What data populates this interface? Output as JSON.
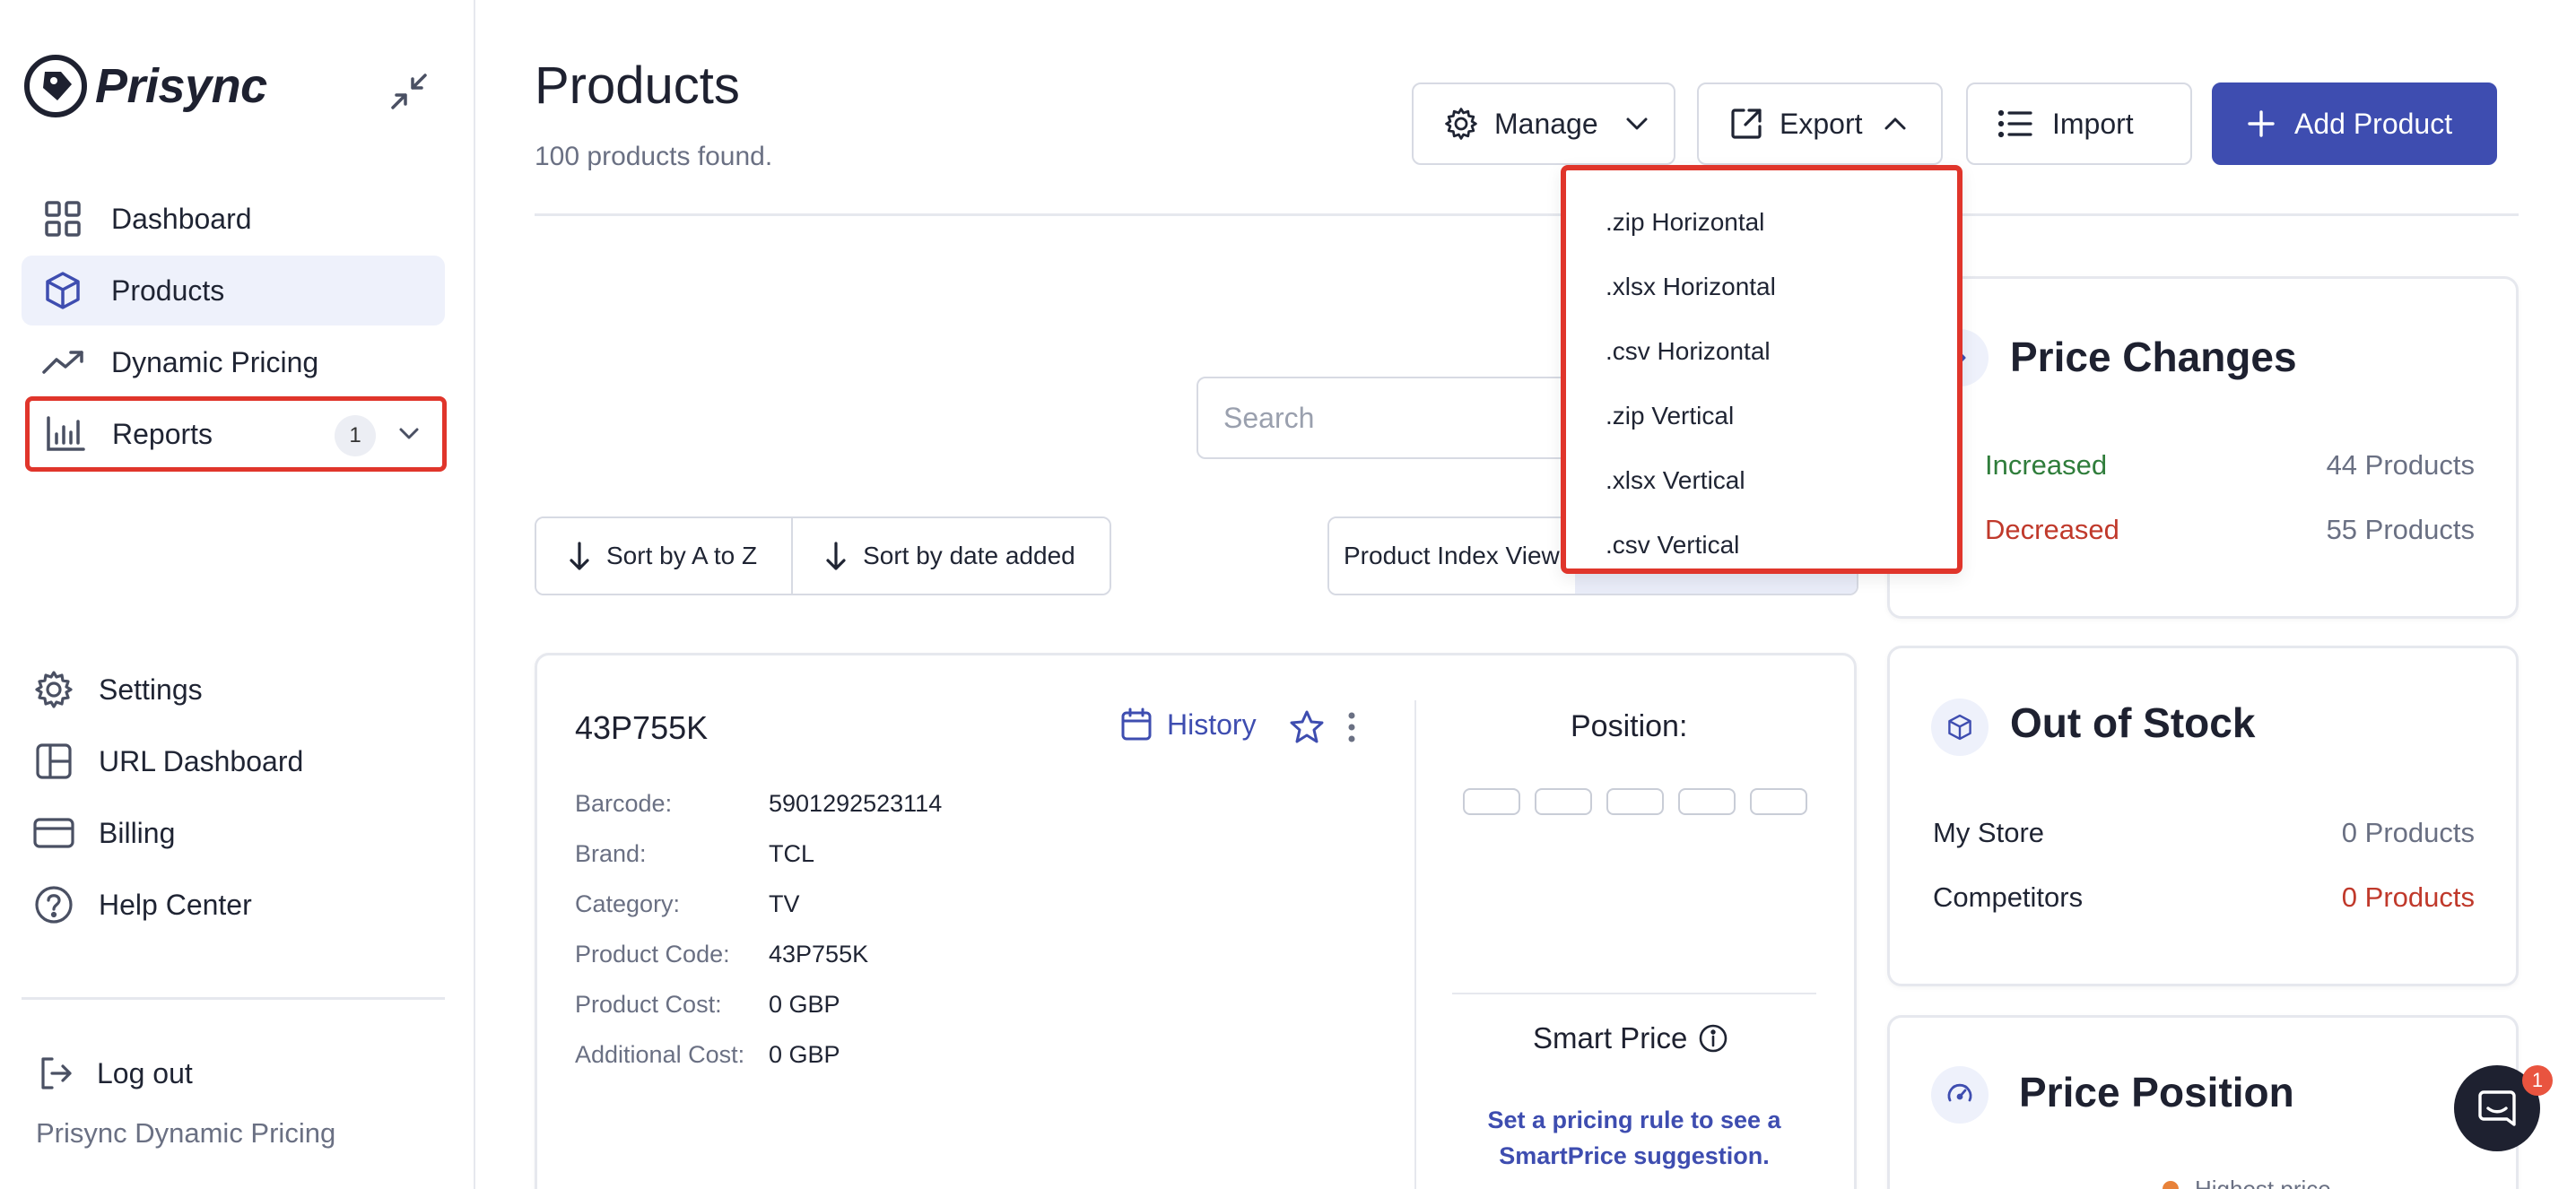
{
  "app": {
    "brand": "Prisync",
    "colors": {
      "accent": "#3e4db0",
      "highlight_border": "#e0352b",
      "increase": "#2f7d3b",
      "decrease": "#c0392b"
    }
  },
  "sidebar": {
    "items": [
      {
        "label": "Dashboard",
        "icon": "grid-icon"
      },
      {
        "label": "Products",
        "icon": "cube-icon",
        "active": true
      },
      {
        "label": "Dynamic Pricing",
        "icon": "trend-up-icon"
      },
      {
        "label": "Reports",
        "icon": "bar-chart-icon",
        "badge": "1"
      }
    ],
    "bottom_items": [
      {
        "label": "Settings",
        "icon": "gear-icon"
      },
      {
        "label": "URL Dashboard",
        "icon": "layout-icon"
      },
      {
        "label": "Billing",
        "icon": "credit-card-icon"
      },
      {
        "label": "Help Center",
        "icon": "help-circle-icon"
      }
    ],
    "logout_label": "Log out",
    "footer_text": "Prisync Dynamic Pricing"
  },
  "header": {
    "title": "Products",
    "subtitle": "100 products found.",
    "manage_label": "Manage",
    "export_label": "Export",
    "import_label": "Import",
    "add_label": "Add Product"
  },
  "export_menu": {
    "items": [
      ".zip Horizontal",
      ".xlsx Horizontal",
      ".csv Horizontal",
      ".zip Vertical",
      ".xlsx Vertical",
      ".csv Vertical"
    ]
  },
  "toolbar": {
    "search_placeholder": "Search",
    "sort_az_label": "Sort by A to Z",
    "sort_date_label": "Sort by date added",
    "view_index_label": "Product Index View"
  },
  "product": {
    "name": "43P755K",
    "history_label": "History",
    "attributes": [
      {
        "key": "Barcode:",
        "value": "5901292523114"
      },
      {
        "key": "Brand:",
        "value": "TCL"
      },
      {
        "key": "Category:",
        "value": "TV"
      },
      {
        "key": "Product Code:",
        "value": "43P755K"
      },
      {
        "key": "Product Cost:",
        "value": "0 GBP"
      },
      {
        "key": "Additional Cost:",
        "value": "0 GBP"
      }
    ],
    "position_title": "Position:",
    "smart_price_title": "Smart Price",
    "smart_price_note": "Set a pricing rule to see a SmartPrice suggestion."
  },
  "price_changes": {
    "title": "Price Changes",
    "increased_label": "Increased",
    "increased_value": "44 Products",
    "decreased_label": "Decreased",
    "decreased_value": "55 Products"
  },
  "out_of_stock": {
    "title": "Out of Stock",
    "my_store_label": "My Store",
    "my_store_value": "0 Products",
    "competitors_label": "Competitors",
    "competitors_value": "0 Products"
  },
  "price_position": {
    "title": "Price Position",
    "legend_partial": "Highest price"
  },
  "chat": {
    "badge": "1"
  }
}
